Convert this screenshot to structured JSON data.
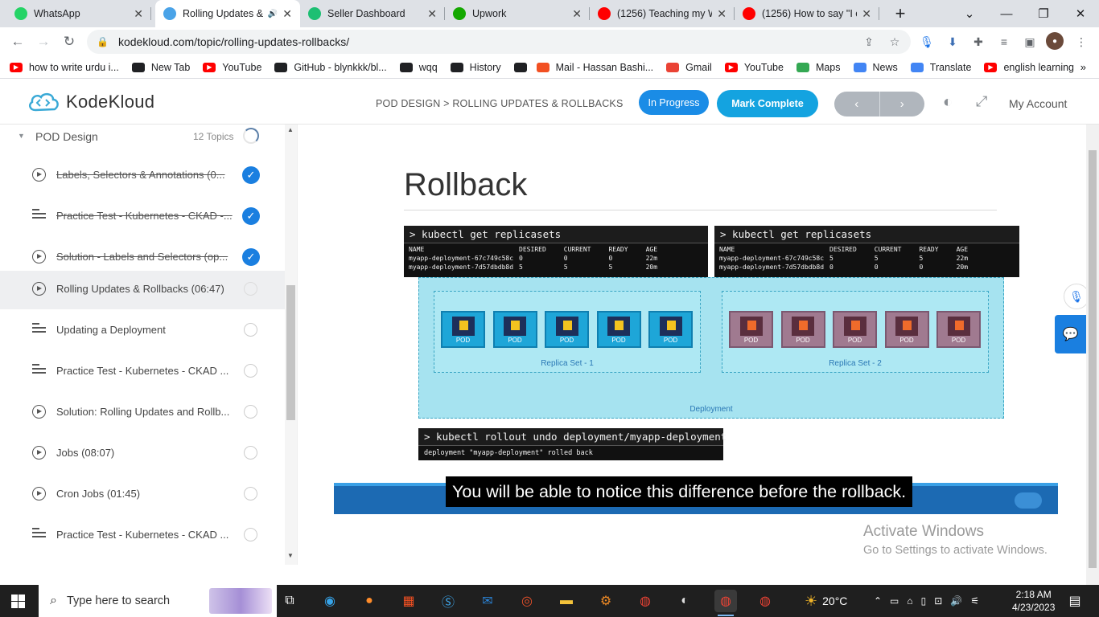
{
  "browser": {
    "tabs": [
      {
        "title": "WhatsApp",
        "icon": "whatsapp-icon",
        "color": "#25d366",
        "active": false
      },
      {
        "title": "Rolling Updates &",
        "icon": "kodekloud-icon",
        "color": "#4aa3e8",
        "active": true
      },
      {
        "title": "Seller Dashboard",
        "icon": "fiverr-icon",
        "color": "#1dbf73",
        "active": false
      },
      {
        "title": "Upwork",
        "icon": "upwork-icon",
        "color": "#14a800",
        "active": false
      },
      {
        "title": "(1256) Teaching my W",
        "icon": "youtube-icon",
        "color": "#ff0000",
        "active": false
      },
      {
        "title": "(1256) How to say \"I c",
        "icon": "youtube-icon",
        "color": "#ff0000",
        "active": false
      }
    ],
    "url": "kodekloud.com/topic/rolling-updates-rollbacks/",
    "bookmarks": [
      {
        "label": "how to write urdu i...",
        "icon": "youtube-icon",
        "color": "#ff0000"
      },
      {
        "label": "New Tab",
        "icon": "globe-icon",
        "color": "#202124"
      },
      {
        "label": "YouTube",
        "icon": "youtube-icon",
        "color": "#ff0000"
      },
      {
        "label": "GitHub - blynkkk/bl...",
        "icon": "github-icon",
        "color": "#202124"
      },
      {
        "label": "wqq",
        "icon": "download-icon",
        "color": "#202124"
      },
      {
        "label": "History",
        "icon": "history-icon",
        "color": "#202124"
      },
      {
        "label": "",
        "icon": "globe-icon",
        "color": "#202124"
      },
      {
        "label": "Mail - Hassan Bashi...",
        "icon": "microsoft-icon",
        "color": "#f25022"
      },
      {
        "label": "Gmail",
        "icon": "gmail-icon",
        "color": "#ea4335"
      },
      {
        "label": "YouTube",
        "icon": "youtube-icon",
        "color": "#ff0000"
      },
      {
        "label": "Maps",
        "icon": "maps-icon",
        "color": "#34a853"
      },
      {
        "label": "News",
        "icon": "news-icon",
        "color": "#4285f4"
      },
      {
        "label": "Translate",
        "icon": "translate-icon",
        "color": "#4285f4"
      },
      {
        "label": "english learning",
        "icon": "youtube-icon",
        "color": "#ff0000"
      }
    ]
  },
  "header": {
    "logo": "KodeKloud",
    "breadcrumb": "POD DESIGN > ROLLING UPDATES & ROLLBACKS",
    "in_progress": "In Progress",
    "mark_complete": "Mark Complete",
    "prev": "‹",
    "next": "›",
    "my_account": "My Account",
    "accent": "#14a3e0"
  },
  "sidebar": {
    "section": {
      "name": "POD Design",
      "count": "12 Topics"
    },
    "items": [
      {
        "label": "Labels, Selectors & Annotations (0...",
        "type": "video",
        "status": "done"
      },
      {
        "label": "Practice Test - Kubernetes - CKAD -...",
        "type": "lab",
        "status": "done"
      },
      {
        "label": "Solution - Labels and Selectors (op...",
        "type": "video",
        "status": "done"
      },
      {
        "label": "Rolling Updates & Rollbacks (06:47)",
        "type": "video",
        "status": "current"
      },
      {
        "label": "Updating a Deployment",
        "type": "lab",
        "status": "todo"
      },
      {
        "label": "Practice Test - Kubernetes - CKAD ...",
        "type": "lab",
        "status": "todo"
      },
      {
        "label": "Solution: Rolling Updates and Rollb...",
        "type": "video",
        "status": "todo"
      },
      {
        "label": "Jobs (08:07)",
        "type": "video",
        "status": "todo"
      },
      {
        "label": "Cron Jobs (01:45)",
        "type": "video",
        "status": "todo"
      },
      {
        "label": "Practice Test - Kubernetes - CKAD ...",
        "type": "lab",
        "status": "todo"
      }
    ]
  },
  "slide": {
    "title": "Rollback",
    "left_terminal": {
      "command": "> kubectl get replicasets",
      "headers": [
        "NAME",
        "DESIRED",
        "CURRENT",
        "READY",
        "AGE"
      ],
      "rows": [
        [
          "myapp-deployment-67c749c58c",
          "0",
          "0",
          "0",
          "22m"
        ],
        [
          "myapp-deployment-7d57dbdb8d",
          "5",
          "5",
          "5",
          "20m"
        ]
      ]
    },
    "right_terminal": {
      "command": "> kubectl get replicasets",
      "headers": [
        "NAME",
        "DESIRED",
        "CURRENT",
        "READY",
        "AGE"
      ],
      "rows": [
        [
          "myapp-deployment-67c749c58c",
          "5",
          "5",
          "5",
          "22m"
        ],
        [
          "myapp-deployment-7d57dbdb8d",
          "0",
          "0",
          "0",
          "20m"
        ]
      ]
    },
    "replica_set_1": "Replica Set - 1",
    "replica_set_2": "Replica Set - 2",
    "pod_label": "POD",
    "deployment_label": "Deployment",
    "undo_terminal": {
      "command": "> kubectl rollout undo deployment/myapp-deployment",
      "output": "deployment \"myapp-deployment\" rolled back"
    }
  },
  "caption": "You will be able to notice this difference before the rollback.",
  "watermark": {
    "line1": "Activate Windows",
    "line2": "Go to Settings to activate Windows."
  },
  "taskbar": {
    "search_placeholder": "Type here to search",
    "weather": "20°C",
    "time": "2:18 AM",
    "date": "4/23/2023"
  }
}
